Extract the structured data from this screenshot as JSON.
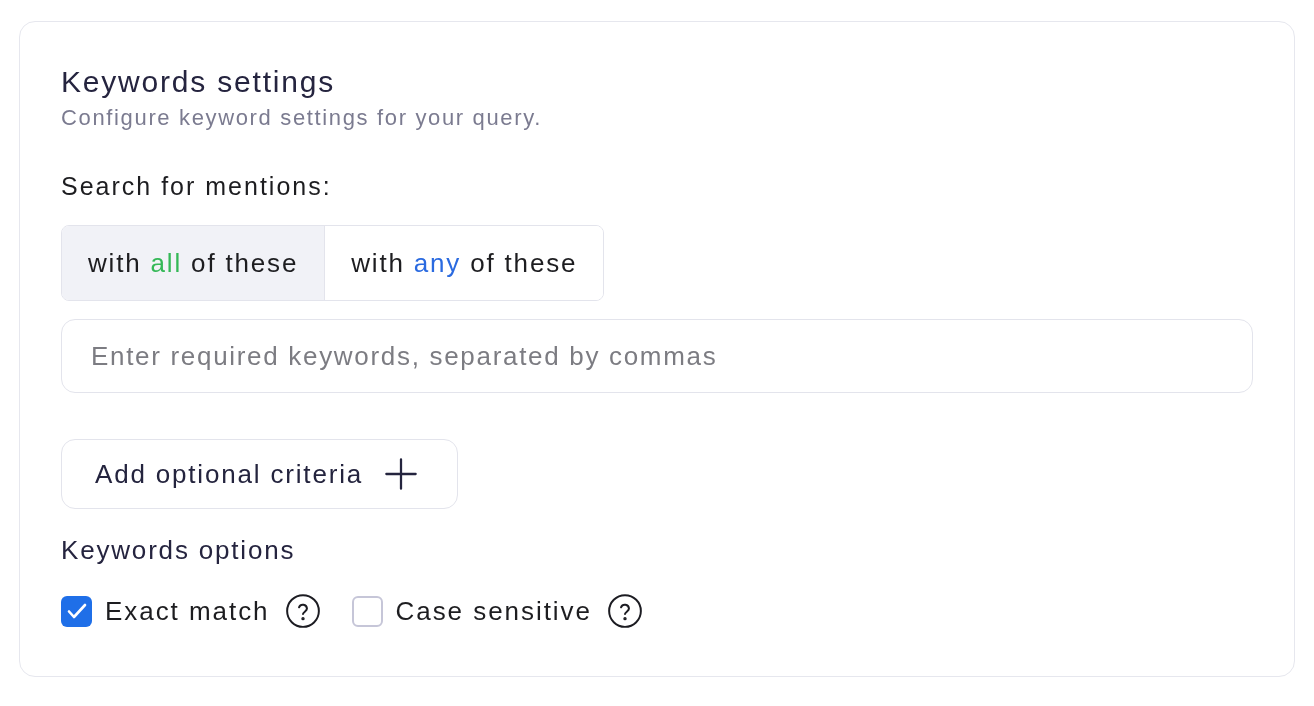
{
  "card": {
    "title": "Keywords settings",
    "subtitle": "Configure keyword settings for your query."
  },
  "match_mode": {
    "label": "Search for mentions:",
    "options": [
      {
        "prefix": "with",
        "highlight": "all",
        "suffix": "of these",
        "color": "#34b857",
        "selected": true
      },
      {
        "prefix": "with",
        "highlight": "any",
        "suffix": "of these",
        "color": "#2a6ae0",
        "selected": false
      }
    ]
  },
  "keywords_field": {
    "placeholder": "Enter required keywords, separated by commas"
  },
  "add_button": {
    "label": "Add optional criteria"
  },
  "keyword_options": {
    "title": "Keywords options",
    "items": [
      {
        "label": "Exact match",
        "checked": true
      },
      {
        "label": "Case sensitive",
        "checked": false
      }
    ]
  }
}
